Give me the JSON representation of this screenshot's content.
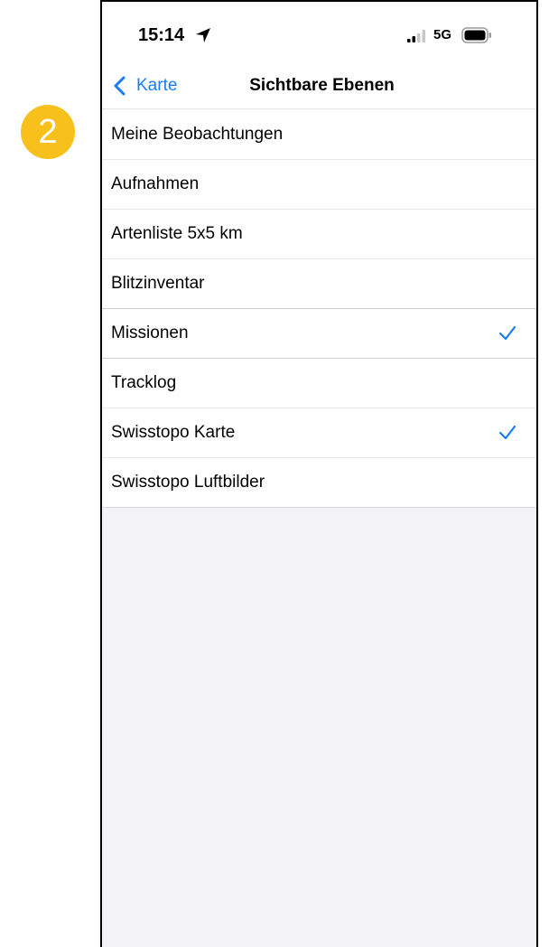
{
  "status_bar": {
    "time": "15:14",
    "network": "5G",
    "location_icon": "location-arrow-icon",
    "signal_icon": "signal-bars-icon",
    "battery_icon": "battery-icon"
  },
  "nav": {
    "back_label": "Karte",
    "back_icon": "chevron-left-icon",
    "title": "Sichtbare Ebenen"
  },
  "layers": [
    {
      "label": "Meine Beobachtungen",
      "checked": false
    },
    {
      "label": "Aufnahmen",
      "checked": false
    },
    {
      "label": "Artenliste 5x5 km",
      "checked": false
    },
    {
      "label": "Blitzinventar",
      "checked": false
    },
    {
      "label": "Missionen",
      "checked": true
    },
    {
      "label": "Tracklog",
      "checked": false
    },
    {
      "label": "Swisstopo Karte",
      "checked": true
    },
    {
      "label": "Swisstopo Luftbilder",
      "checked": false
    }
  ],
  "annotation": {
    "step_number": "2"
  },
  "colors": {
    "accent": "#1a7cf6",
    "badge": "#f8c01b",
    "grouped_background": "#f2f2f7"
  }
}
